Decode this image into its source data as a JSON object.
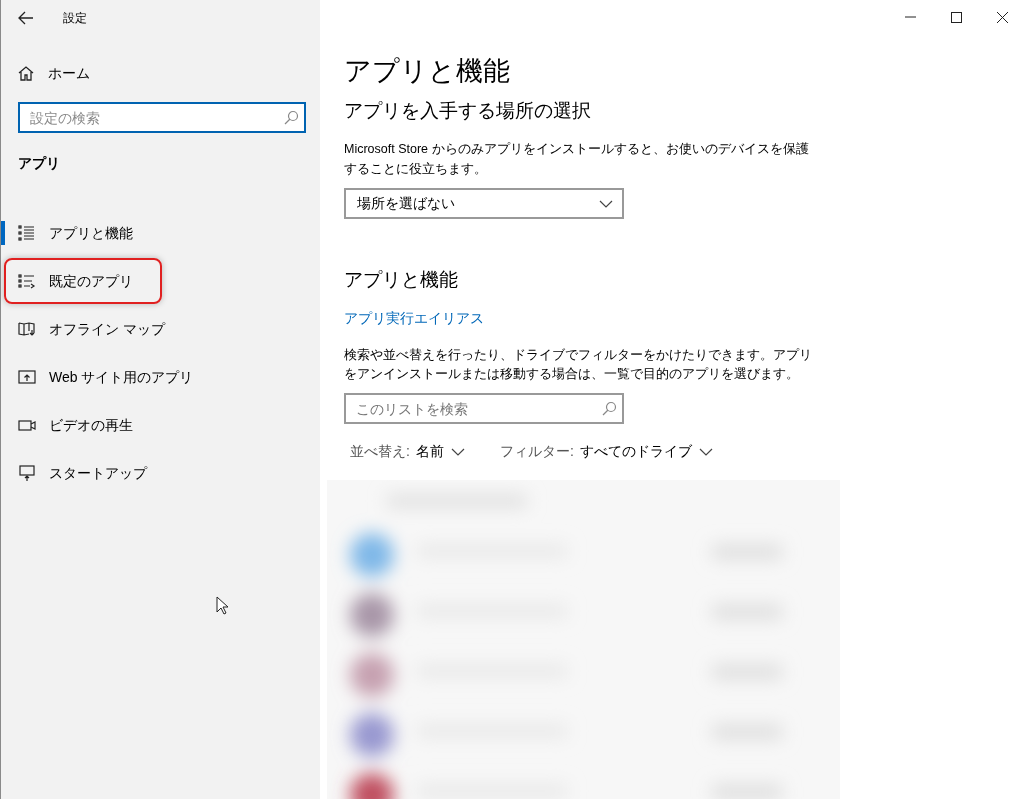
{
  "window": {
    "title": "設定"
  },
  "sidebar": {
    "home": "ホーム",
    "search": {
      "placeholder": "設定の検索"
    },
    "section": "アプリ",
    "items": [
      {
        "label": "アプリと機能",
        "selected": true,
        "highlighted": false
      },
      {
        "label": "既定のアプリ",
        "selected": false,
        "highlighted": true
      },
      {
        "label": "オフライン マップ",
        "selected": false,
        "highlighted": false
      },
      {
        "label": "Web サイト用のアプリ",
        "selected": false,
        "highlighted": false
      },
      {
        "label": "ビデオの再生",
        "selected": false,
        "highlighted": false
      },
      {
        "label": "スタートアップ",
        "selected": false,
        "highlighted": false
      }
    ]
  },
  "main": {
    "title": "アプリと機能",
    "source_heading": "アプリを入手する場所の選択",
    "source_description": "Microsoft Store からのみアプリをインストールすると、お使いのデバイスを保護することに役立ちます。",
    "source_dropdown": {
      "value": "場所を選ばない"
    },
    "features_heading": "アプリと機能",
    "alias_link": "アプリ実行エイリアス",
    "features_description": "検索や並べ替えを行ったり、ドライブでフィルターをかけたりできます。アプリをアンインストールまたは移動する場合は、一覧で目的のアプリを選びます。",
    "list_search": {
      "placeholder": "このリストを検索"
    },
    "sort": {
      "label": "並べ替え:",
      "value": "名前"
    },
    "filter": {
      "label": "フィルター:",
      "value": "すべてのドライブ"
    }
  }
}
